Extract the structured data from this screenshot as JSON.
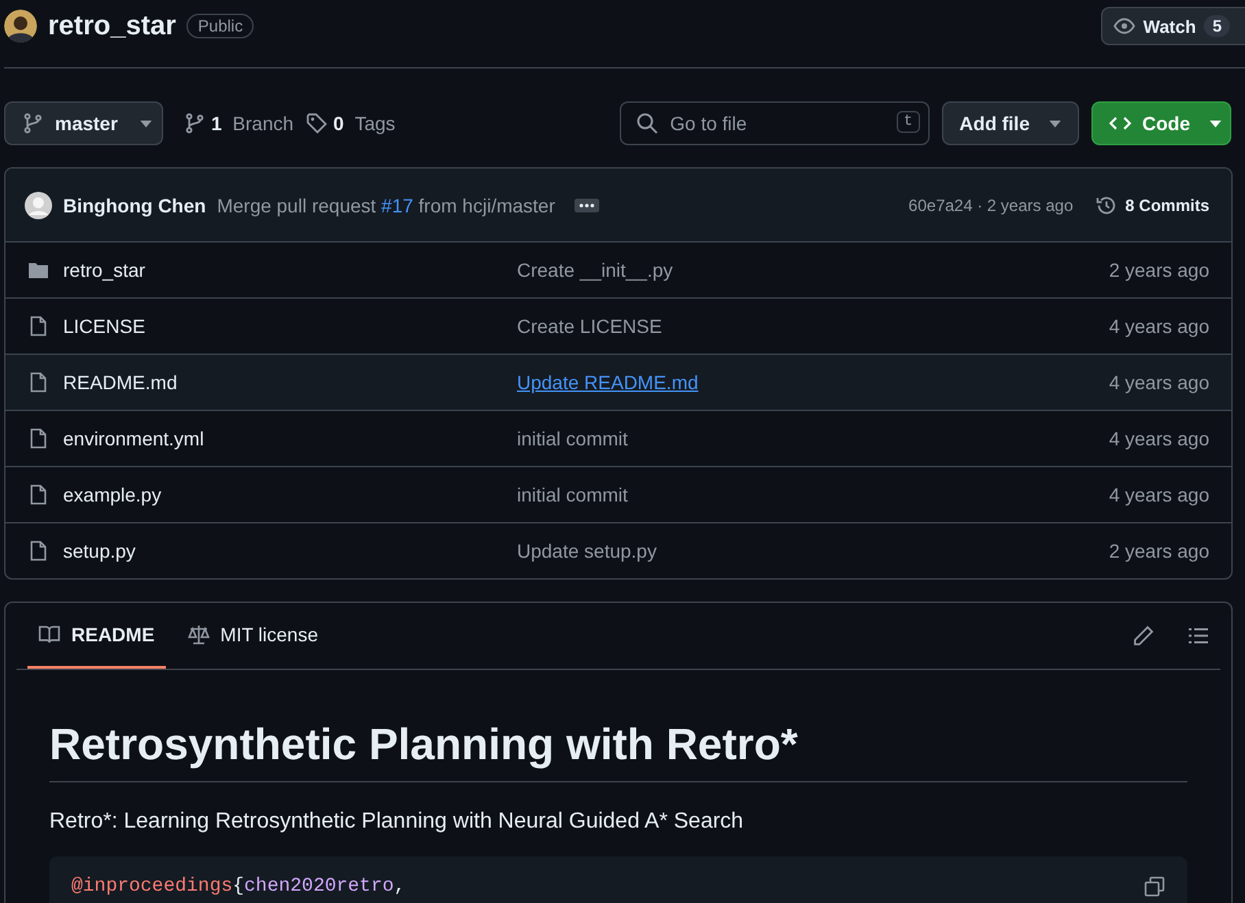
{
  "repo": {
    "name": "retro_star",
    "visibility": "Public",
    "watch": {
      "label": "Watch",
      "count": "5"
    }
  },
  "toolbar": {
    "branch": "master",
    "branches": {
      "count": "1",
      "label": "Branch"
    },
    "tags": {
      "count": "0",
      "label": "Tags"
    },
    "search": {
      "placeholder": "Go to file",
      "shortcut": "t"
    },
    "add_file": "Add file",
    "code": "Code"
  },
  "latest_commit": {
    "author": "Binghong Chen",
    "message_before": "Merge pull request ",
    "pr_link": "#17",
    "message_after": " from hcji/master",
    "hash_time": "60e7a24 · 2 years ago",
    "commits": "8 Commits"
  },
  "files": [
    {
      "kind": "folder",
      "name": "retro_star",
      "message": "Create __init__.py",
      "time": "2 years ago",
      "highlighted": false
    },
    {
      "kind": "file",
      "name": "LICENSE",
      "message": "Create LICENSE",
      "time": "4 years ago",
      "highlighted": false
    },
    {
      "kind": "file",
      "name": "README.md",
      "message": "Update README.md",
      "time": "4 years ago",
      "highlighted": true
    },
    {
      "kind": "file",
      "name": "environment.yml",
      "message": "initial commit",
      "time": "4 years ago",
      "highlighted": false
    },
    {
      "kind": "file",
      "name": "example.py",
      "message": "initial commit",
      "time": "4 years ago",
      "highlighted": false
    },
    {
      "kind": "file",
      "name": "setup.py",
      "message": "Update setup.py",
      "time": "2 years ago",
      "highlighted": false
    }
  ],
  "readme": {
    "tabs": [
      {
        "kind": "book",
        "label": "README",
        "selected": true
      },
      {
        "kind": "scale",
        "label": "MIT license",
        "selected": false
      }
    ],
    "heading": "Retrosynthetic Planning with Retro*",
    "paragraph": "Retro*: Learning Retrosynthetic Planning with Neural Guided A* Search",
    "code": [
      {
        "kind": "keyword",
        "text": "@inproceedings"
      },
      {
        "kind": "punct",
        "text": "{"
      },
      {
        "kind": "name",
        "text": "chen2020retro"
      },
      {
        "kind": "punct",
        "text": ","
      }
    ]
  }
}
